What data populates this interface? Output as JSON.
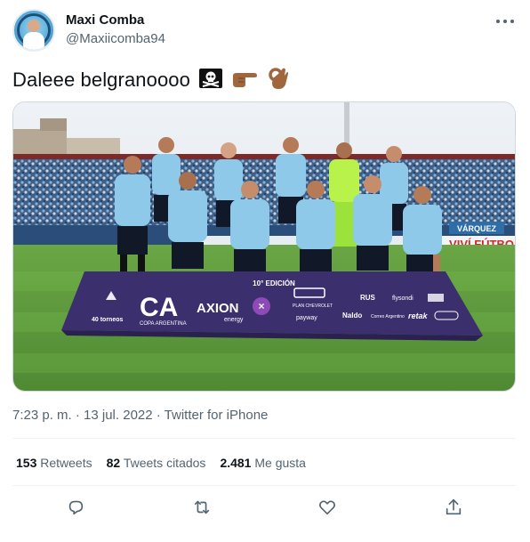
{
  "author": {
    "name": "Maxi Comba",
    "handle": "@Maxiicomba94"
  },
  "tweet": {
    "text": "Daleee belgranoooo",
    "emoji_icons": [
      "skull-crossbones-icon",
      "pointing-right-hand-icon",
      "ok-hand-icon"
    ]
  },
  "photo": {
    "banner_edition": "10° EDICIÓN",
    "banner_sponsors": [
      "CA",
      "COPA ARGENTINA",
      "AXION",
      "energy",
      "PLAN CHEVROLET",
      "RUS",
      "flysondi",
      "payway",
      "Naldo",
      "Correo Argentino",
      "retak",
      "40 torneos"
    ],
    "ad_board_text": "VIVÍ FÚTBO",
    "ad_board_text2": "VÁRQUEZ"
  },
  "meta": {
    "timestamp": "7:23 p. m. · 13 jul. 2022 · Twitter for iPhone"
  },
  "stats": {
    "retweets_count": "153",
    "retweets_label": "Retweets",
    "quotes_count": "82",
    "quotes_label": "Tweets citados",
    "likes_count": "2.481",
    "likes_label": "Me gusta"
  },
  "colors": {
    "text_primary": "#0f1419",
    "text_secondary": "#536471",
    "divider": "#eff3f4",
    "jersey": "#8ec9ea",
    "banner": "#3b2f6e",
    "pitch": "#5f9a3c"
  }
}
